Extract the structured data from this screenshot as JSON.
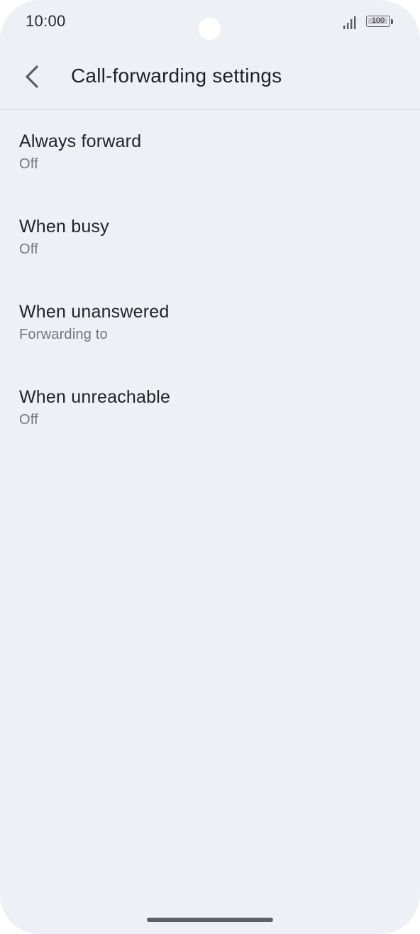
{
  "status_bar": {
    "time": "10:00",
    "battery_level": "100"
  },
  "app_bar": {
    "title": "Call-forwarding settings"
  },
  "settings": [
    {
      "title": "Always forward",
      "summary": "Off"
    },
    {
      "title": "When busy",
      "summary": "Off"
    },
    {
      "title": "When unanswered",
      "summary": "Forwarding to"
    },
    {
      "title": "When unreachable",
      "summary": "Off"
    }
  ],
  "icons": {
    "back": "arrow-back-icon",
    "signal": "cellular-signal-icon",
    "battery": "battery-icon"
  },
  "colors": {
    "background": "#eff0f5",
    "primary_text": "#1f1f24",
    "secondary_text": "#75757c"
  }
}
